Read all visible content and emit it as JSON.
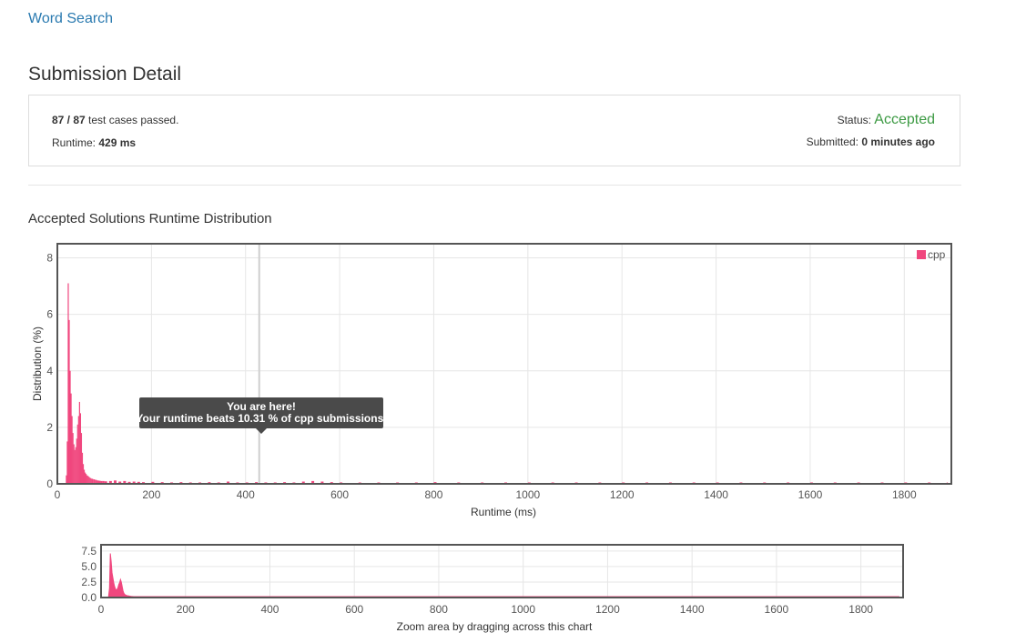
{
  "problem_link": "Word Search",
  "page_title": "Submission Detail",
  "summary": {
    "passed": "87 / 87",
    "passed_suffix": " test cases passed.",
    "runtime_label": "Runtime: ",
    "runtime_value": "429 ms",
    "status_label": "Status: ",
    "status_value": "Accepted",
    "submitted_label": "Submitted: ",
    "submitted_value": "0 minutes ago",
    "colors": {
      "accepted": "#3c9a43",
      "link": "#2a7ab0"
    }
  },
  "distribution_title": "Accepted Solutions Runtime Distribution",
  "tooltip": {
    "line1": "You are here!",
    "line2": "Your runtime beats 10.31 % of cpp submissions."
  },
  "navigator_caption": "Zoom area by dragging across this chart",
  "chart_data": [
    {
      "type": "bar",
      "xlabel": "Runtime (ms)",
      "ylabel": "Distribution (%)",
      "xlim": [
        0,
        1900
      ],
      "ylim": [
        0,
        8.5
      ],
      "xticks": [
        0,
        200,
        400,
        600,
        800,
        1000,
        1200,
        1400,
        1600,
        1800
      ],
      "yticks": [
        0,
        2,
        4,
        6,
        8
      ],
      "legend": "top-right",
      "grid": true,
      "color": "#f0477e",
      "marker_x": 429,
      "series": [
        {
          "name": "cpp",
          "x": [
            18,
            20,
            22,
            24,
            26,
            28,
            30,
            32,
            34,
            36,
            38,
            40,
            42,
            44,
            46,
            48,
            50,
            52,
            54,
            56,
            58,
            60,
            62,
            64,
            66,
            68,
            70,
            72,
            76,
            80,
            84,
            88,
            92,
            96,
            100,
            110,
            120,
            130,
            140,
            150,
            160,
            170,
            180,
            200,
            220,
            240,
            260,
            280,
            300,
            320,
            340,
            360,
            380,
            400,
            420,
            440,
            460,
            480,
            500,
            520,
            540,
            560,
            580,
            600,
            640,
            680,
            720,
            760,
            800,
            850,
            900,
            950,
            1000,
            1050,
            1100,
            1150,
            1200,
            1250,
            1300,
            1350,
            1400,
            1450,
            1500,
            1550,
            1600,
            1650,
            1700,
            1750,
            1800,
            1850,
            1890
          ],
          "values": [
            0.3,
            1.5,
            7.1,
            5.8,
            4.0,
            3.2,
            2.4,
            1.8,
            1.4,
            1.2,
            1.3,
            1.6,
            2.1,
            2.4,
            2.9,
            2.5,
            1.8,
            1.1,
            0.7,
            0.5,
            0.4,
            0.35,
            0.3,
            0.28,
            0.25,
            0.22,
            0.2,
            0.18,
            0.16,
            0.14,
            0.12,
            0.11,
            0.1,
            0.1,
            0.09,
            0.1,
            0.12,
            0.08,
            0.1,
            0.07,
            0.08,
            0.07,
            0.06,
            0.07,
            0.06,
            0.05,
            0.06,
            0.05,
            0.05,
            0.06,
            0.05,
            0.08,
            0.05,
            0.05,
            0.06,
            0.05,
            0.05,
            0.06,
            0.05,
            0.08,
            0.1,
            0.08,
            0.06,
            0.05,
            0.04,
            0.04,
            0.03,
            0.04,
            0.06,
            0.04,
            0.03,
            0.03,
            0.04,
            0.03,
            0.03,
            0.03,
            0.04,
            0.03,
            0.03,
            0.03,
            0.04,
            0.03,
            0.03,
            0.03,
            0.03,
            0.03,
            0.03,
            0.03,
            0.03,
            0.03,
            0.04
          ]
        }
      ]
    },
    {
      "type": "area",
      "xlabel": "",
      "ylabel": "",
      "xlim": [
        0,
        1900
      ],
      "ylim": [
        0,
        8.5
      ],
      "xticks": [
        0,
        200,
        400,
        600,
        800,
        1000,
        1200,
        1400,
        1600,
        1800
      ],
      "yticks": [
        0,
        2.5,
        5,
        7.5
      ],
      "ytick_labels": [
        "0.0",
        "2.5",
        "5.0",
        "7.5"
      ],
      "grid": true,
      "color": "#f0477e"
    }
  ]
}
